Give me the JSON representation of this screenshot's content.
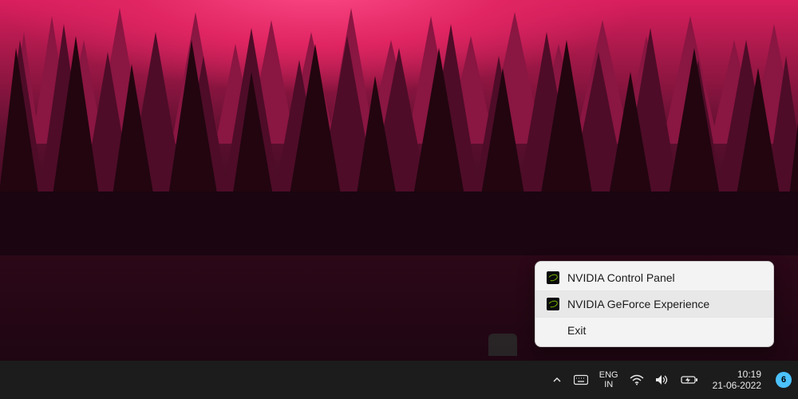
{
  "context_menu": {
    "items": [
      {
        "label": "NVIDIA Control Panel",
        "icon": "nvidia-icon",
        "hovered": false
      },
      {
        "label": "NVIDIA GeForce Experience",
        "icon": "nvidia-icon",
        "hovered": true
      },
      {
        "label": "Exit",
        "icon": null,
        "hovered": false
      }
    ]
  },
  "taskbar": {
    "language": {
      "top": "ENG",
      "bottom": "IN"
    },
    "clock": {
      "time": "10:19",
      "date": "21-06-2022"
    },
    "notification_count": "6",
    "icons": {
      "chevron": "chevron-up-icon",
      "touchkbd": "touch-keyboard-icon",
      "wifi": "wifi-icon",
      "volume": "volume-icon",
      "battery": "battery-charging-icon"
    }
  },
  "colors": {
    "taskbar_bg": "#1c1c1c",
    "menu_bg": "#f3f3f3",
    "menu_hover": "#e8e8e8",
    "notif_badge": "#4cc2ff",
    "nvidia_green": "#76b900"
  }
}
